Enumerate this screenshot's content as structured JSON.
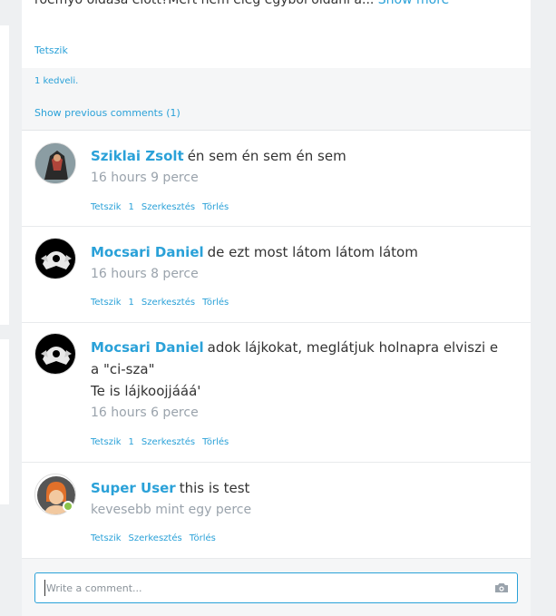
{
  "post": {
    "text": "roemyo oldasa elott?Mert nem eleg egybol oldani a...",
    "show_more": "Show more",
    "like_label": "Tetszik",
    "likes_text": "1 kedveli.",
    "previous_comments": "Show previous comments (1)"
  },
  "comments": [
    {
      "author": "Sziklai Zsolt",
      "text": "én sem én sem én sem",
      "extra": "",
      "time": "16 hours 9 perce",
      "actions": {
        "like": "Tetszik",
        "count": "1",
        "edit": "Szerkesztés",
        "delete": "Törlés"
      }
    },
    {
      "author": "Mocsari Daniel",
      "text": "de ezt most látom látom látom",
      "extra": "",
      "time": "16 hours 8 perce",
      "actions": {
        "like": "Tetszik",
        "count": "1",
        "edit": "Szerkesztés",
        "delete": "Törlés"
      }
    },
    {
      "author": "Mocsari Daniel",
      "text": "adok lájkokat, meglátjuk holnapra elviszi e a \"ci-sza\"",
      "extra": "Te is lájkoojjááá'",
      "time": "16 hours 6 perce",
      "actions": {
        "like": "Tetszik",
        "count": "1",
        "edit": "Szerkesztés",
        "delete": "Törlés"
      }
    },
    {
      "author": "Super User",
      "text": "this is test",
      "extra": "",
      "time": "kevesebb mint egy perce",
      "online": true,
      "actions": {
        "like": "Tetszik",
        "edit": "Szerkesztés",
        "delete": "Törlés"
      }
    }
  ],
  "composer": {
    "placeholder": "Write a comment...",
    "value": "",
    "camera_icon": "camera-icon"
  },
  "colors": {
    "accent": "#2aa1d8",
    "background": "#eef0f2",
    "muted": "#9aa3ac",
    "online": "#8bc34a"
  }
}
